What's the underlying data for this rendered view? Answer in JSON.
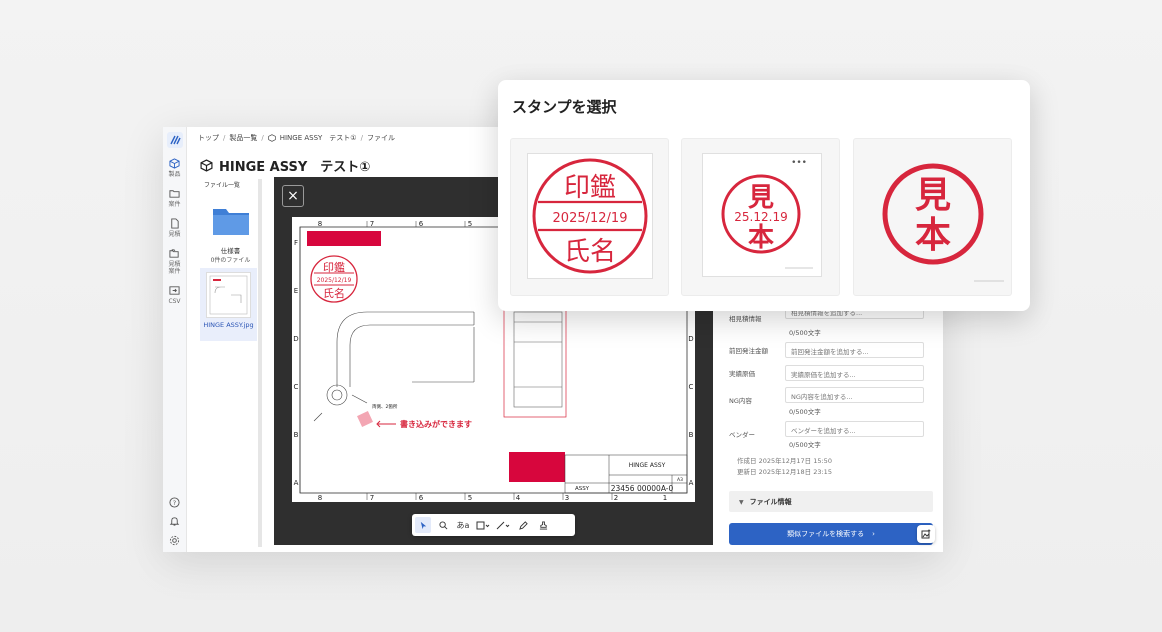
{
  "breadcrumb": [
    "トップ",
    "製品一覧",
    "HINGE ASSY　テスト①",
    "ファイル"
  ],
  "page_title": "HINGE ASSY　テスト①",
  "rail": {
    "items": [
      {
        "label": "製品",
        "icon": "cube-icon"
      },
      {
        "label": "案件",
        "icon": "folder-icon"
      },
      {
        "label": "見積",
        "icon": "document-icon"
      },
      {
        "label": "見積\n案件",
        "icon": "folders-icon"
      },
      {
        "label": "CSV",
        "icon": "export-icon"
      }
    ]
  },
  "file_panel": {
    "header": "ファイル一覧",
    "folder_name": "仕様書",
    "folder_sub": "0件のファイル",
    "file_name": "HINGE ASSY.jpg"
  },
  "drawing": {
    "col_labels": [
      "8",
      "7",
      "6",
      "5",
      "4",
      "3",
      "2",
      "1"
    ],
    "row_labels": [
      "F",
      "E",
      "D",
      "C",
      "B",
      "A"
    ],
    "stamp_top": "印鑑",
    "stamp_date": "2025/12/19",
    "stamp_bottom": "氏名",
    "annotation": "書き込みができます",
    "note": "両側、2箇所",
    "title_block_name": "HINGE ASSY",
    "title_block_assy": "ASSY",
    "title_block_number": "23456 00000A-0",
    "title_block_size": "A3"
  },
  "toolbar": {
    "items": [
      "select",
      "zoom",
      "text",
      "rect",
      "line",
      "pen",
      "stamp"
    ],
    "text_tool_label": "あa"
  },
  "right_panel": {
    "fields": [
      {
        "label": "相見積情報",
        "placeholder": "相見積情報を追加する...",
        "counter": "0/500文字"
      },
      {
        "label": "前回発注金額",
        "placeholder": "前回発注金額を追加する..."
      },
      {
        "label": "実績原価",
        "placeholder": "実績原価を追加する..."
      },
      {
        "label": "NG内容",
        "placeholder": "NG内容を追加する...",
        "counter": "0/500文字"
      },
      {
        "label": "ベンダー",
        "placeholder": "ベンダーを追加する...",
        "counter": "0/500文字"
      }
    ],
    "created": "作成日 2025年12月17日 15:50",
    "updated": "更新日 2025年12月18日 23:15",
    "file_info_label": "ファイル情報",
    "search_button": "類似ファイルを検索する"
  },
  "modal": {
    "title": "スタンプを選択",
    "stamps": [
      {
        "top": "印鑑",
        "date": "2025/12/19",
        "bottom": "氏名"
      },
      {
        "top": "見",
        "date": "25.12.19",
        "bottom": "本"
      },
      {
        "top": "見",
        "bottom": "本"
      }
    ]
  },
  "colors": {
    "accent": "#2d63c4",
    "stamp_red": "#d7263d",
    "viewer_bg": "#2f2f2f"
  }
}
